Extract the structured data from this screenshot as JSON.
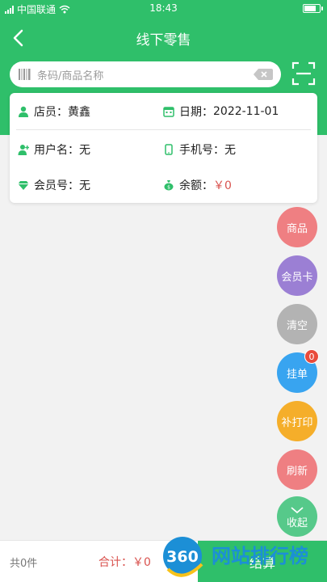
{
  "statusbar": {
    "carrier": "中国联通",
    "time": "18:43"
  },
  "header": {
    "title": "线下零售"
  },
  "search": {
    "placeholder": "条码/商品名称"
  },
  "info": {
    "clerk_label": "店员：",
    "clerk_value": "黄鑫",
    "date_label": "日期：",
    "date_value": "2022-11-01",
    "username_label": "用户名：",
    "username_value": "无",
    "phone_label": "手机号：",
    "phone_value": "无",
    "member_label": "会员号：",
    "member_value": "无",
    "balance_label": "余额：",
    "balance_value": "￥0"
  },
  "fab": {
    "goods": "商品",
    "member_card": "会员卡",
    "clear": "清空",
    "hold": "挂单",
    "hold_badge": "0",
    "reprint": "补打印",
    "refresh": "刷新",
    "collapse": "收起"
  },
  "colors": {
    "primary": "#2fbf6a",
    "goods": "#ef7f82",
    "member_card": "#9b7fd4",
    "clear": "#b3b3b3",
    "hold": "#38a4f0",
    "reprint": "#f5ae2a",
    "refresh": "#ef7f82",
    "collapse": "#56c98a"
  },
  "bottom": {
    "count": "共0件",
    "total_label": "合计：￥0",
    "checkout": "结算"
  },
  "watermark": {
    "logo_text": "360",
    "brand_text": "网站排行榜"
  }
}
